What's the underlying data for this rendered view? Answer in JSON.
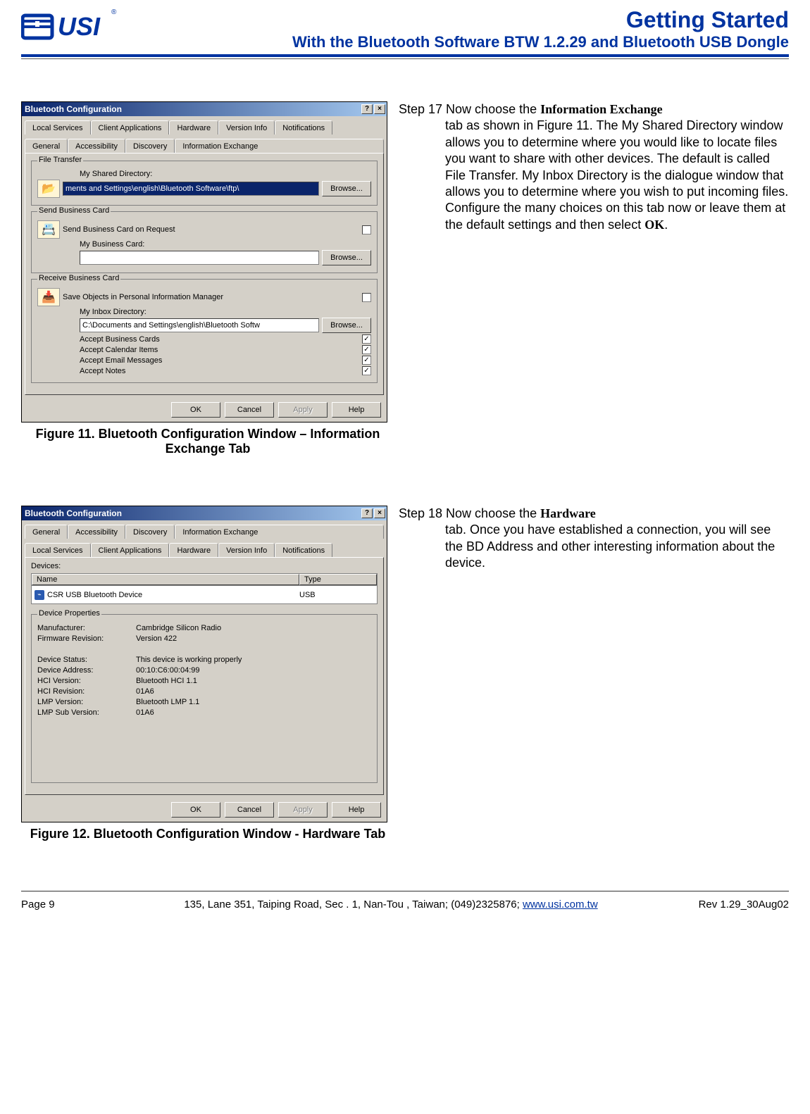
{
  "header": {
    "title_main": "Getting Started",
    "title_sub": "With the Bluetooth Software BTW 1.2.29 and Bluetooth USB Dongle"
  },
  "step17": {
    "lead": "Step 17 Now choose the ",
    "bold1": "Information Exchange",
    "cont": " tab as shown in Figure 11. The My Shared Directory window allows you to determine where you would like to locate files you want to share with other devices. The default is called File Transfer. My Inbox Directory is the dialogue window that allows you to determine where you wish to put incoming files. Configure the many choices on this tab now or leave them at the default settings and then select ",
    "bold2": "OK",
    "tail": "."
  },
  "step18": {
    "lead": "Step 18 Now choose the ",
    "bold1": "Hardware",
    "cont": " tab. Once you have established a connection, you will see the BD Address and other interesting information about the device."
  },
  "fig11": {
    "caption": "Figure 11. Bluetooth Configuration Window – Information Exchange Tab",
    "title": "Bluetooth Configuration",
    "tabs_row1": [
      "Local Services",
      "Client Applications",
      "Hardware",
      "Version Info",
      "Notifications"
    ],
    "tabs_row2": [
      "General",
      "Accessibility",
      "Discovery",
      "Information Exchange"
    ],
    "file_transfer": {
      "group": "File Transfer",
      "label": "My Shared Directory:",
      "value": "ments and Settings\\english\\Bluetooth Software\\ftp\\",
      "browse": "Browse..."
    },
    "send_card": {
      "group": "Send Business Card",
      "lbl1": "Send Business Card on Request",
      "lbl2": "My Business Card:",
      "value": "",
      "browse": "Browse..."
    },
    "recv_card": {
      "group": "Receive Business Card",
      "lbl1": "Save Objects in Personal Information Manager",
      "lbl2": "My Inbox Directory:",
      "value": "C:\\Documents and Settings\\english\\Bluetooth Softw",
      "browse": "Browse...",
      "accept": [
        "Accept Business Cards",
        "Accept Calendar Items",
        "Accept Email Messages",
        "Accept Notes"
      ]
    },
    "buttons": {
      "ok": "OK",
      "cancel": "Cancel",
      "apply": "Apply",
      "help": "Help"
    }
  },
  "fig12": {
    "caption": "Figure 12. Bluetooth Configuration Window - Hardware Tab",
    "title": "Bluetooth Configuration",
    "tabs_row1": [
      "General",
      "Accessibility",
      "Discovery",
      "Information Exchange"
    ],
    "tabs_row2": [
      "Local Services",
      "Client Applications",
      "Hardware",
      "Version Info",
      "Notifications"
    ],
    "devices_lbl": "Devices:",
    "cols": [
      "Name",
      "Type"
    ],
    "device": {
      "name": "CSR USB Bluetooth Device",
      "type": "USB"
    },
    "props_group": "Device Properties",
    "props": [
      [
        "Manufacturer:",
        "Cambridge Silicon Radio"
      ],
      [
        "Firmware Revision:",
        "Version 422"
      ],
      [
        "",
        ""
      ],
      [
        "Device Status:",
        "This device is working properly"
      ],
      [
        "Device Address:",
        "00:10:C6:00:04:99"
      ],
      [
        "HCI Version:",
        "Bluetooth HCI 1.1"
      ],
      [
        "HCI Revision:",
        "01A6"
      ],
      [
        "LMP Version:",
        "Bluetooth LMP 1.1"
      ],
      [
        "LMP Sub Version:",
        "01A6"
      ]
    ],
    "buttons": {
      "ok": "OK",
      "cancel": "Cancel",
      "apply": "Apply",
      "help": "Help"
    }
  },
  "footer": {
    "page": "Page 9",
    "address_pre": "135, Lane 351, Taiping Road, Sec . 1, Nan-Tou , Taiwan; (049)2325876; ",
    "url": "www.usi.com.tw",
    "rev": "Rev 1.29_30Aug02"
  }
}
